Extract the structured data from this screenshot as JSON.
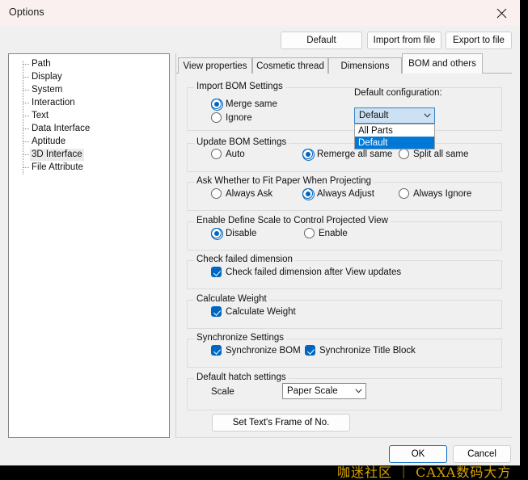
{
  "window": {
    "title": "Options",
    "close_icon": "close-icon"
  },
  "toolbar": {
    "default_label": "Default",
    "import_label": "Import from file",
    "export_label": "Export to file"
  },
  "sidebar": {
    "items": [
      {
        "label": "Path",
        "selected": false
      },
      {
        "label": "Display",
        "selected": false
      },
      {
        "label": "System",
        "selected": false
      },
      {
        "label": "Interaction",
        "selected": false
      },
      {
        "label": "Text",
        "selected": false
      },
      {
        "label": "Data Interface",
        "selected": false
      },
      {
        "label": "Aptitude",
        "selected": false
      },
      {
        "label": "3D Interface",
        "selected": true
      },
      {
        "label": "File Attribute",
        "selected": false
      }
    ]
  },
  "tabs": [
    {
      "label": "View properties",
      "active": false
    },
    {
      "label": "Cosmetic thread",
      "active": false
    },
    {
      "label": "Dimensions",
      "active": false
    },
    {
      "label": "BOM and others",
      "active": true
    }
  ],
  "groups": {
    "import_bom": {
      "legend": "Import BOM Settings",
      "options": [
        {
          "label": "Merge same",
          "selected": true
        },
        {
          "label": "Ignore",
          "selected": false
        }
      ],
      "config_label": "Default configuration:",
      "config_value": "Default",
      "config_open": true,
      "config_options": [
        {
          "label": "All Parts",
          "selected": false
        },
        {
          "label": "Default",
          "selected": true
        }
      ]
    },
    "update_bom": {
      "legend": "Update BOM Settings",
      "options": [
        {
          "label": "Auto",
          "selected": false
        },
        {
          "label": "Remerge all same",
          "selected": true
        },
        {
          "label": "Split all same",
          "selected": false
        }
      ]
    },
    "fit_paper": {
      "legend": "Ask Whether to Fit Paper When Projecting",
      "options": [
        {
          "label": "Always Ask",
          "selected": false
        },
        {
          "label": "Always Adjust",
          "selected": true
        },
        {
          "label": "Always Ignore",
          "selected": false
        }
      ]
    },
    "define_scale": {
      "legend": "Enable Define Scale to Control Projected View",
      "options": [
        {
          "label": "Disable",
          "selected": true
        },
        {
          "label": "Enable",
          "selected": false
        }
      ]
    },
    "check_failed": {
      "legend": "Check failed dimension",
      "checks": [
        {
          "label": "Check failed dimension after View updates",
          "checked": true
        }
      ]
    },
    "calculate_weight": {
      "legend": "Calculate Weight",
      "checks": [
        {
          "label": "Calculate Weight",
          "checked": true
        }
      ]
    },
    "synchronize": {
      "legend": "Synchronize Settings",
      "checks": [
        {
          "label": "Synchronize BOM",
          "checked": true
        },
        {
          "label": "Synchronize Title Block",
          "checked": true
        }
      ]
    },
    "hatch": {
      "legend": "Default hatch settings",
      "scale_label": "Scale",
      "scale_value": "Paper Scale"
    }
  },
  "buttons": {
    "set_text_frame": "Set Text's Frame of No.",
    "ok": "OK",
    "cancel": "Cancel"
  },
  "watermark": {
    "text": "咖迷社区 ｜ CAXA数码大方",
    "color": "#d6a300"
  },
  "colors": {
    "accent": "#0067c0",
    "highlight": "#0078d7",
    "titlebar": "#faf0f0",
    "dialog": "#f0f0f0"
  }
}
